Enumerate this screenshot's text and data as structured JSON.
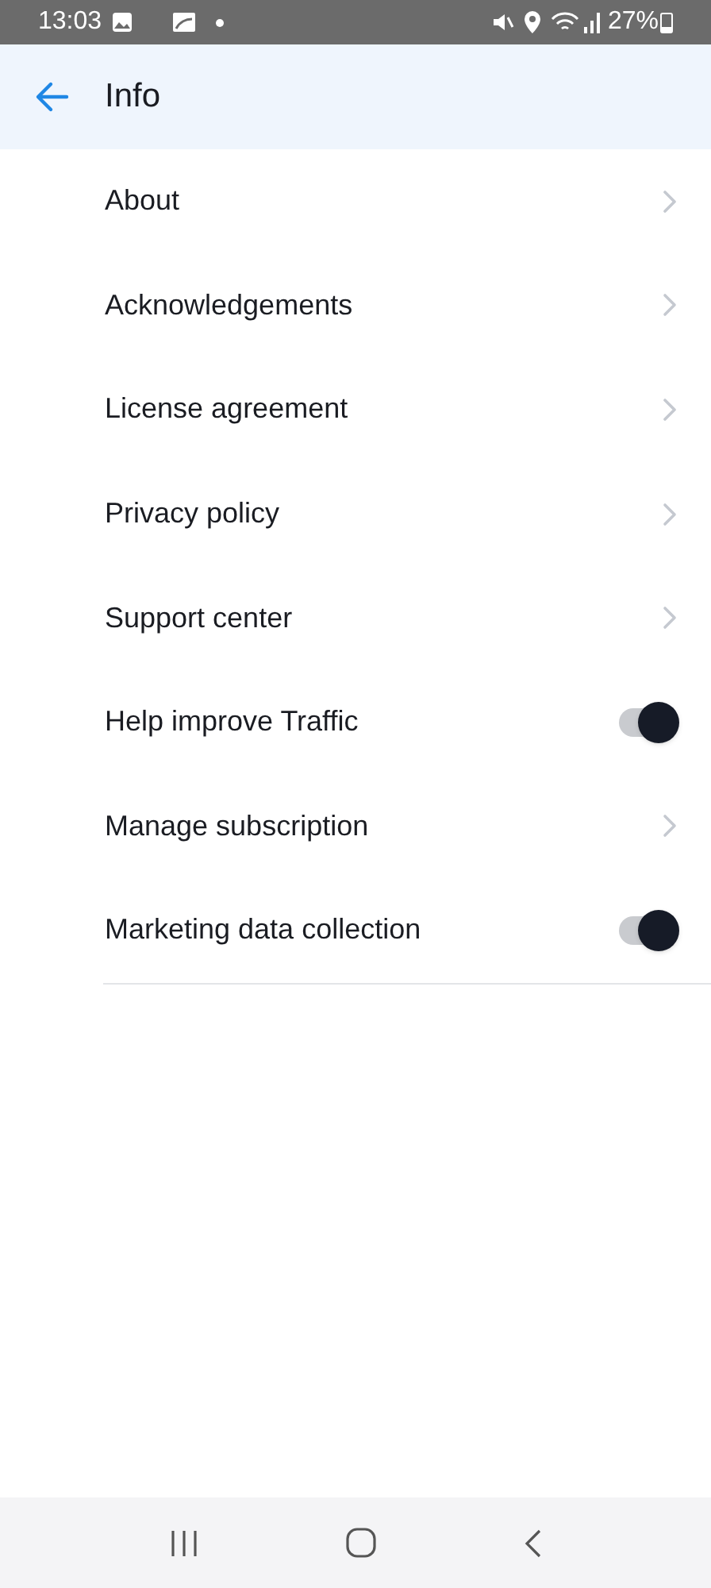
{
  "status_bar": {
    "time": "13:03",
    "battery": "27%"
  },
  "header": {
    "title": "Info"
  },
  "items": [
    {
      "kind": "link",
      "label": "About"
    },
    {
      "kind": "link",
      "label": "Acknowledgements"
    },
    {
      "kind": "link",
      "label": "License agreement"
    },
    {
      "kind": "link",
      "label": "Privacy policy"
    },
    {
      "kind": "link",
      "label": "Support center"
    },
    {
      "kind": "toggle",
      "label": "Help improve Traffic",
      "on": true
    },
    {
      "kind": "link",
      "label": "Manage subscription"
    },
    {
      "kind": "toggle",
      "label": "Marketing data collection",
      "on": true
    }
  ]
}
